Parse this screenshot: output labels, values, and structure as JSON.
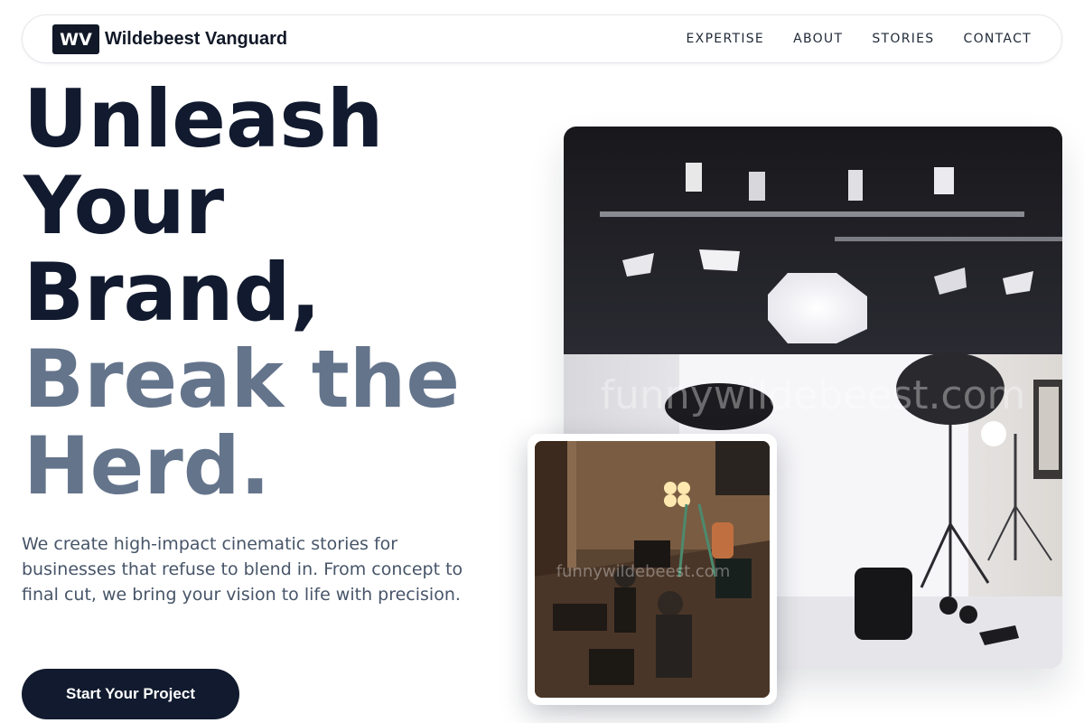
{
  "nav": {
    "logo_mark": "WV",
    "brand_name": "Wildebeest Vanguard",
    "links": [
      "EXPERTISE",
      "ABOUT",
      "STORIES",
      "CONTACT"
    ]
  },
  "hero": {
    "headline_dark": [
      "Unleash",
      "Your",
      "Brand,"
    ],
    "headline_muted": [
      "Break the",
      "Herd."
    ],
    "lead": "We create high-impact cinematic stories for businesses that refuse to blend in. From concept to final cut, we bring your vision to life with precision.",
    "cta_label": "Start Your Project"
  },
  "images": {
    "main_watermark": "funnywildebeest.com",
    "secondary_watermark": "funnywildebeest.com"
  },
  "colors": {
    "dark": "#111a2e",
    "muted": "#64748b",
    "body_text": "#475569"
  }
}
